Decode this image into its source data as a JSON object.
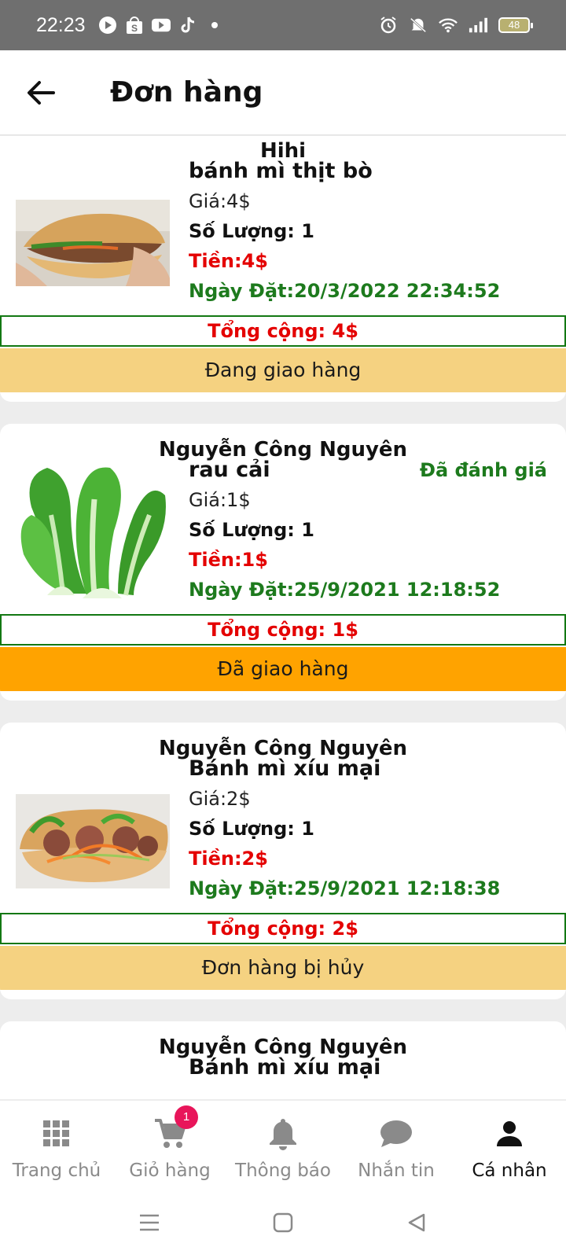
{
  "status_bar": {
    "time": "22:23",
    "battery": "48",
    "left_icons": [
      "play-icon",
      "shop-icon",
      "youtube-icon",
      "tiktok-icon",
      "dot-icon"
    ],
    "right_icons": [
      "alarm-icon",
      "mute-icon",
      "wifi-icon",
      "signal-icon",
      "battery-icon"
    ]
  },
  "header": {
    "title": "Đơn hàng",
    "back_icon": "arrow-left-icon"
  },
  "orders": [
    {
      "shop": "Hihi",
      "item": "bánh mì thịt bò",
      "price": "Giá:4$",
      "quantity": "Số Lượng: 1",
      "money": "Tiền:4$",
      "date": "Ngày Đặt:20/3/2022 22:34:52",
      "rating": "",
      "total": "Tổng cộng: 4$",
      "status": "Đang giao hàng",
      "status_color": "#f5d281",
      "image": "banh-mi-beef-image"
    },
    {
      "shop": "Nguyễn Công Nguyên",
      "item": "rau cải",
      "price": "Giá:1$",
      "quantity": "Số Lượng: 1",
      "money": "Tiền:1$",
      "date": "Ngày Đặt:25/9/2021 12:18:52",
      "rating": "Đã đánh giá",
      "total": "Tổng cộng: 1$",
      "status": "Đã giao hàng",
      "status_color": "#ffa300",
      "image": "bok-choy-image"
    },
    {
      "shop": "Nguyễn Công Nguyên",
      "item": "Bánh mì xíu mại",
      "price": "Giá:2$",
      "quantity": "Số Lượng: 1",
      "money": "Tiền:2$",
      "date": "Ngày Đặt:25/9/2021 12:18:38",
      "rating": "",
      "total": "Tổng cộng: 2$",
      "status": "Đơn hàng bị hủy",
      "status_color": "#f5d281",
      "image": "banh-mi-meatball-image"
    },
    {
      "shop": "Nguyễn Công Nguyên",
      "item": "Bánh mì xíu mại"
    }
  ],
  "bottom_nav": [
    {
      "label": "Trang chủ",
      "icon": "grid-icon"
    },
    {
      "label": "Giỏ hàng",
      "icon": "cart-icon",
      "badge": "1"
    },
    {
      "label": "Thông báo",
      "icon": "bell-icon"
    },
    {
      "label": "Nhắn tin",
      "icon": "chat-icon"
    },
    {
      "label": "Cá nhân",
      "icon": "person-icon",
      "active": true
    }
  ],
  "system_nav": [
    "menu-icon",
    "home-icon",
    "back-icon"
  ],
  "colors": {
    "green": "#1d7a1d",
    "red": "#e40000",
    "pending": "#f5d281",
    "delivered": "#ffa300",
    "badge": "#e8155a"
  }
}
